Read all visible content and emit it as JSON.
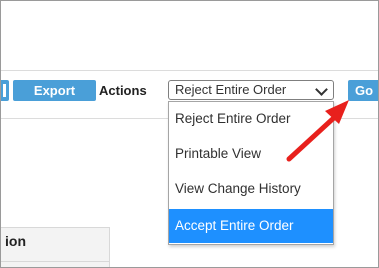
{
  "toolbar": {
    "export_label": "Export",
    "actions_label": "Actions",
    "go_label": "Go"
  },
  "actions_select": {
    "selected": "Reject Entire Order",
    "options": [
      "Reject Entire Order",
      "Printable View",
      "View Change History",
      "Accept Entire Order"
    ],
    "highlighted_index": 3
  },
  "section": {
    "partial_header": "ion"
  },
  "colors": {
    "button_blue": "#4a9fd8",
    "highlight_blue": "#1e90ff",
    "annotation_arrow": "#e8201c"
  }
}
